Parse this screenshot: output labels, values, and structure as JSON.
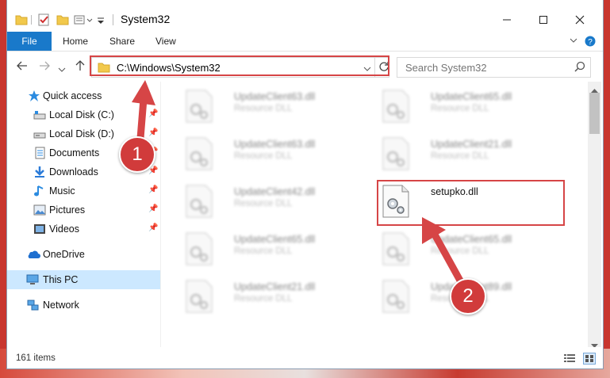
{
  "window": {
    "title": "System32"
  },
  "ribbon": {
    "tabs": [
      "File",
      "Home",
      "Share",
      "View"
    ]
  },
  "address": {
    "path": "C:\\Windows\\System32"
  },
  "search": {
    "placeholder": "Search System32"
  },
  "sidebar": {
    "items": [
      {
        "label": "Quick access",
        "icon": "star-icon"
      },
      {
        "label": "Local Disk (C:)",
        "icon": "drive-icon",
        "pinned": true
      },
      {
        "label": "Local Disk (D:)",
        "icon": "drive-icon",
        "pinned": true
      },
      {
        "label": "Documents",
        "icon": "documents-icon",
        "pinned": true
      },
      {
        "label": "Downloads",
        "icon": "download-icon",
        "pinned": true
      },
      {
        "label": "Music",
        "icon": "music-icon",
        "pinned": true
      },
      {
        "label": "Pictures",
        "icon": "pictures-icon",
        "pinned": true
      },
      {
        "label": "Videos",
        "icon": "videos-icon",
        "pinned": true
      },
      {
        "label": "OneDrive",
        "icon": "cloud-icon"
      },
      {
        "label": "This PC",
        "icon": "computer-icon",
        "selected": true
      },
      {
        "label": "Network",
        "icon": "network-icon"
      }
    ]
  },
  "files": {
    "left": [
      {
        "name": "UpdateClient63.dll",
        "type": "Resource DLL"
      },
      {
        "name": "UpdateClient63.dll",
        "type": "Resource DLL"
      },
      {
        "name": "UpdateClient42.dll",
        "type": "Resource DLL"
      },
      {
        "name": "UpdateClient65.dll",
        "type": "Resource DLL"
      },
      {
        "name": "UpdateClient21.dll",
        "type": "Resource DLL"
      }
    ],
    "right": [
      {
        "name": "UpdateClient65.dll",
        "type": "Resource DLL"
      },
      {
        "name": "UpdateClient21.dll",
        "type": "Resource DLL"
      },
      {
        "name": "setupko.dll",
        "type": ""
      },
      {
        "name": "UpdateClient65.dll",
        "type": "Resource DLL"
      },
      {
        "name": "UpdateClient89.dll",
        "type": "Resource DLL"
      }
    ]
  },
  "status": {
    "count": "161 items"
  },
  "annotations": {
    "badge1": "1",
    "badge2": "2"
  },
  "colors": {
    "accent": "#1979ca",
    "highlight": "#d64546",
    "selected": "#cce8ff"
  }
}
